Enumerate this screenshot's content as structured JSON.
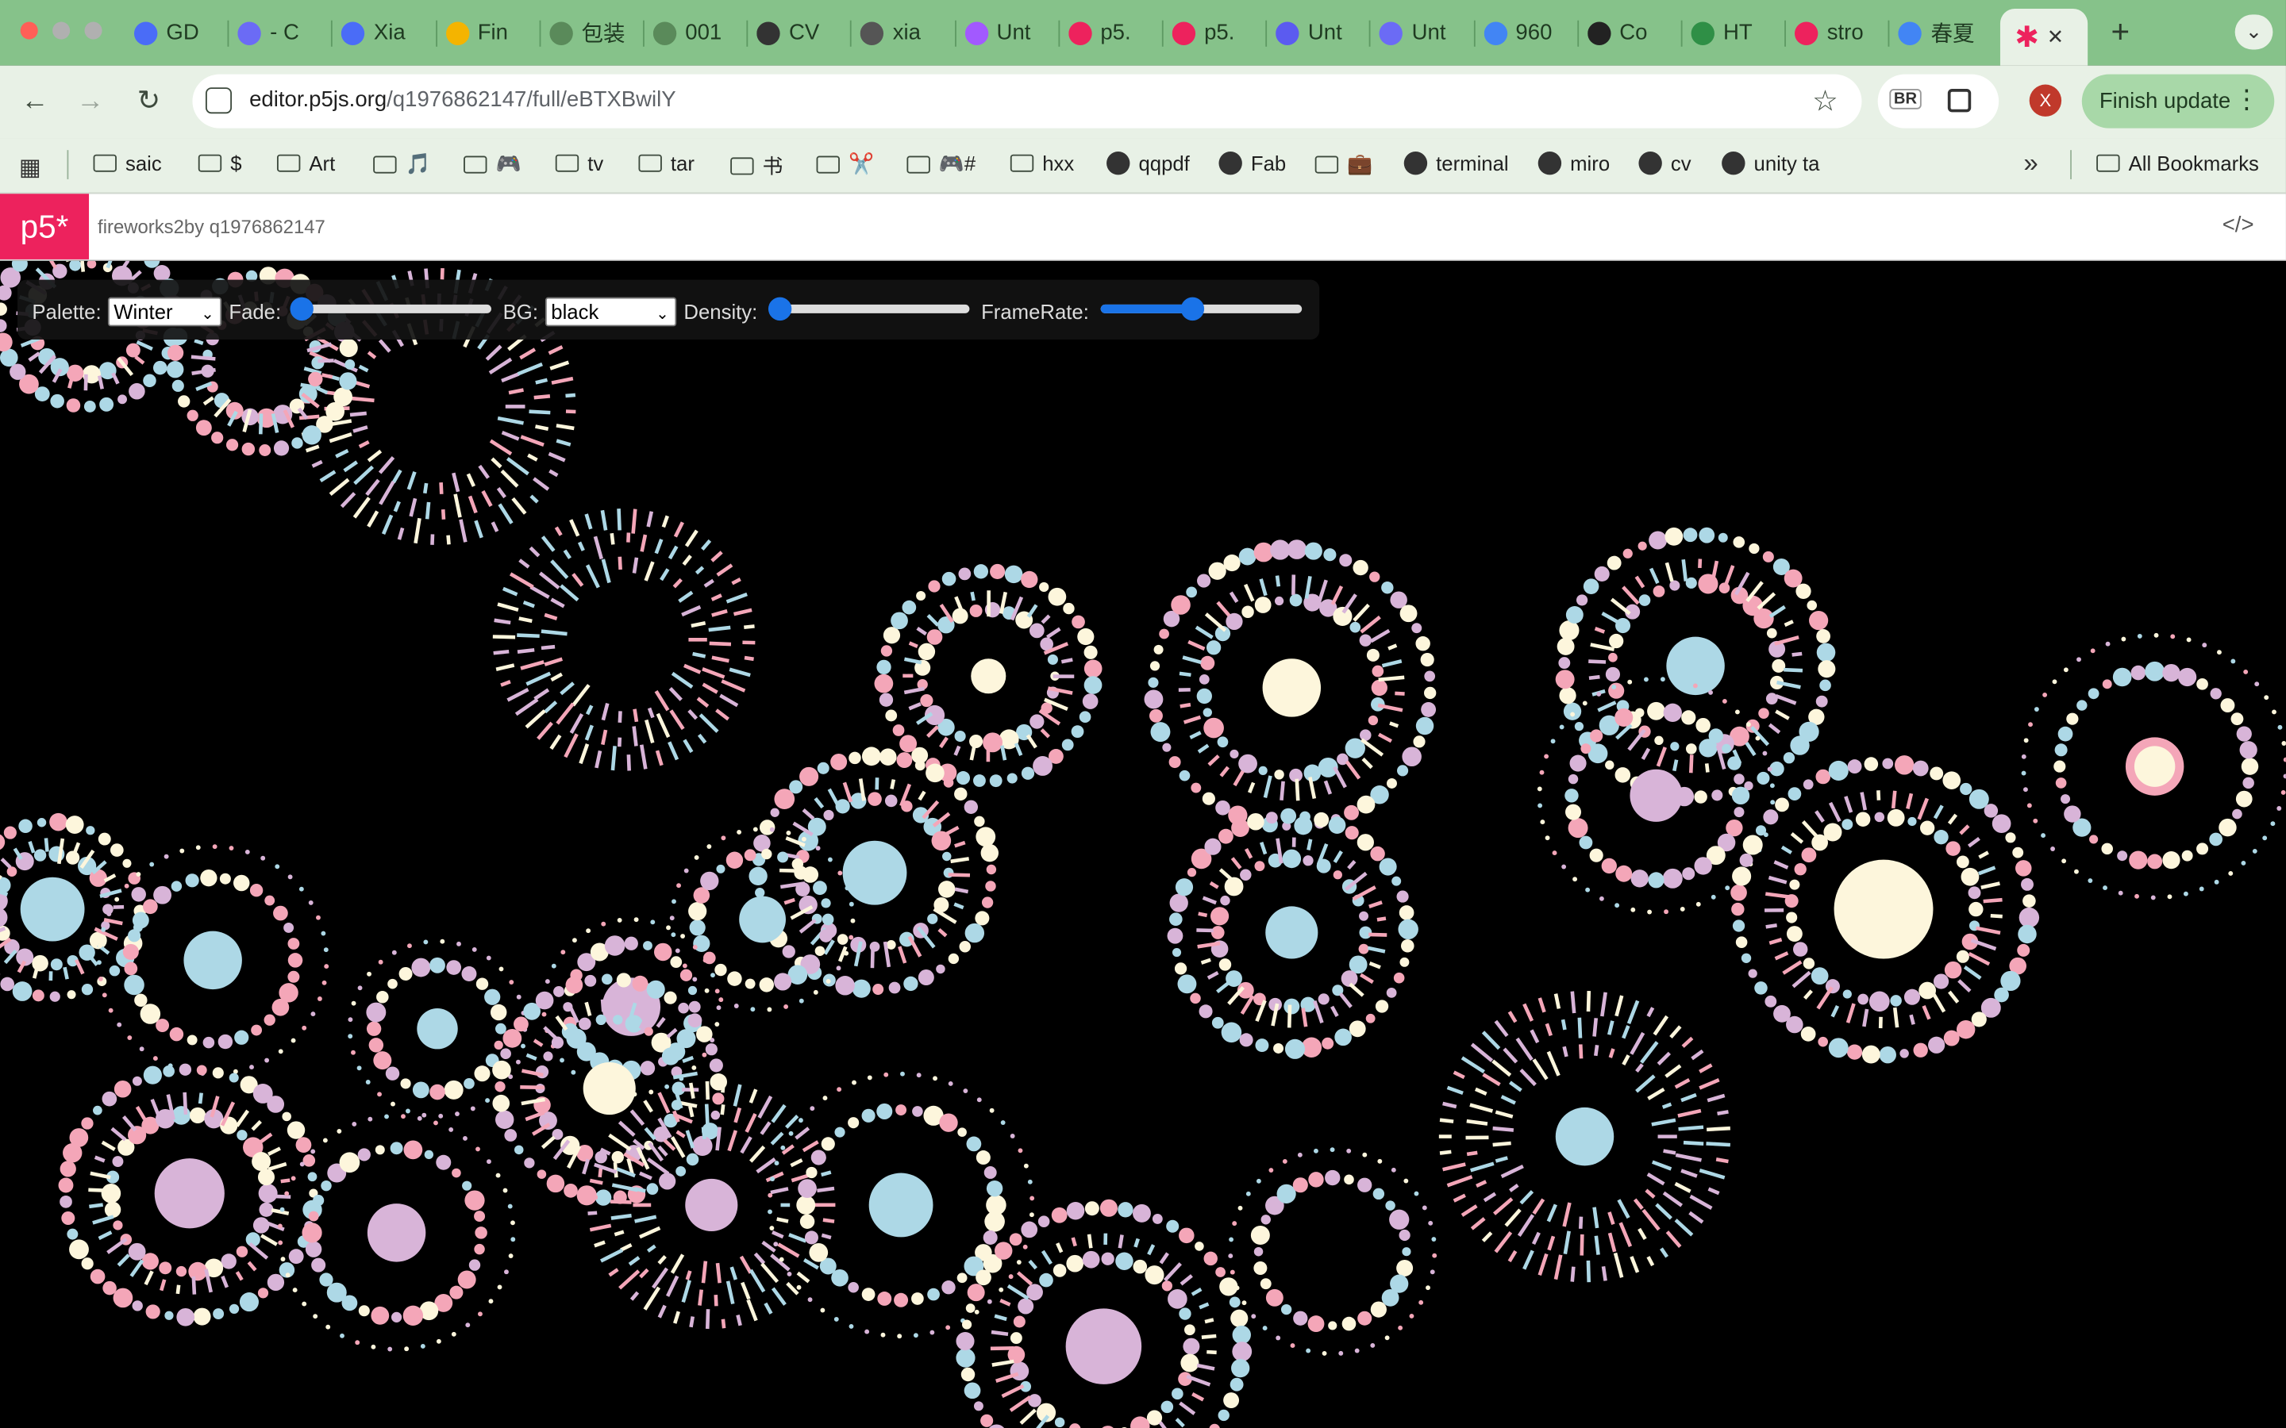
{
  "tabs": [
    {
      "label": "GD",
      "icon": "printer-icon",
      "color": "#4a6cf7"
    },
    {
      "label": "- C",
      "icon": "c-icon",
      "color": "#6b6bf5"
    },
    {
      "label": "Xia",
      "icon": "printer-icon",
      "color": "#4a6cf7"
    },
    {
      "label": "Fin",
      "icon": "drive-icon",
      "color": "#f4b400"
    },
    {
      "label": "包装",
      "icon": "globe-icon",
      "color": "#5a8a5a"
    },
    {
      "label": "001",
      "icon": "globe-icon",
      "color": "#5a8a5a"
    },
    {
      "label": "CV",
      "icon": "globe-icon",
      "color": "#333333"
    },
    {
      "label": "xia",
      "icon": "dark-icon",
      "color": "#555555"
    },
    {
      "label": "Unt",
      "icon": "figma-icon",
      "color": "#a259ff"
    },
    {
      "label": "p5.",
      "icon": "p5-icon",
      "color": "#ed225d"
    },
    {
      "label": "p5.",
      "icon": "p5-icon",
      "color": "#ed225d"
    },
    {
      "label": "Unt",
      "icon": "video-icon",
      "color": "#5b5bf0"
    },
    {
      "label": "Unt",
      "icon": "c-icon",
      "color": "#6b6bf5"
    },
    {
      "label": "960",
      "icon": "google-icon",
      "color": "#4285f4"
    },
    {
      "label": "Co",
      "icon": "openai-icon",
      "color": "#222222"
    },
    {
      "label": "HT",
      "icon": "w-icon",
      "color": "#2f8f46"
    },
    {
      "label": "stro",
      "icon": "p5-icon",
      "color": "#ed225d"
    },
    {
      "label": "春夏",
      "icon": "google-icon",
      "color": "#4285f4"
    }
  ],
  "active_tab": {
    "icon": "p5-icon",
    "close": "✕"
  },
  "new_tab": "+",
  "tab_menu": "⌄",
  "toolbar": {
    "back": "←",
    "forward": "→",
    "reload": "↻",
    "url_host": "editor.p5js.org",
    "url_path": "/q1976862147/full/eBTXBwilY",
    "star": "☆",
    "br_label": "BR",
    "avatar_letter": "X",
    "finish_update": "Finish update",
    "menu": "⋮"
  },
  "bookmarks": [
    {
      "label": "saic",
      "icon": "folder-icon"
    },
    {
      "label": "$",
      "icon": "folder-icon"
    },
    {
      "label": "Art",
      "icon": "folder-icon"
    },
    {
      "label": "🎵",
      "icon": "folder-icon"
    },
    {
      "label": "🎮",
      "icon": "folder-icon"
    },
    {
      "label": "tv",
      "icon": "folder-icon"
    },
    {
      "label": "tar",
      "icon": "folder-icon"
    },
    {
      "label": "书",
      "icon": "folder-icon"
    },
    {
      "label": "✂️",
      "icon": "folder-icon"
    },
    {
      "label": "🎮#",
      "icon": "folder-icon"
    },
    {
      "label": "hxx",
      "icon": "folder-icon"
    },
    {
      "label": "qqpdf",
      "icon": "globe-icon"
    },
    {
      "label": "Fab",
      "icon": "fab-icon"
    },
    {
      "label": "💼",
      "icon": "folder-icon"
    },
    {
      "label": "terminal",
      "icon": "github-icon"
    },
    {
      "label": "miro",
      "icon": "miro-icon"
    },
    {
      "label": "cv",
      "icon": "globe-icon"
    },
    {
      "label": "unity ta",
      "icon": "unity-icon"
    }
  ],
  "bookmarks_more": "»",
  "all_bookmarks": "All Bookmarks",
  "p5": {
    "logo": "p5*",
    "sketch_title": "fireworks2by q1976862147",
    "code_icon": "</>"
  },
  "controls": {
    "palette_label": "Palette:",
    "palette_value": "Winter",
    "fade_label": "Fade:",
    "fade_value": 0,
    "bg_label": "BG:",
    "bg_value": "black",
    "density_label": "Density:",
    "density_value": 0,
    "framerate_label": "FrameRate:",
    "framerate_value": 0.46
  },
  "colors": {
    "tab_bg": "#86c28a",
    "toolbar_bg": "#e8f1e6",
    "p5_pink": "#ed225d",
    "slider_blue": "#1a73e8",
    "firework_palette": [
      "#add8e6",
      "#f4a6b8",
      "#d8b4d8",
      "#fdf6dc",
      "#ffffff"
    ]
  }
}
